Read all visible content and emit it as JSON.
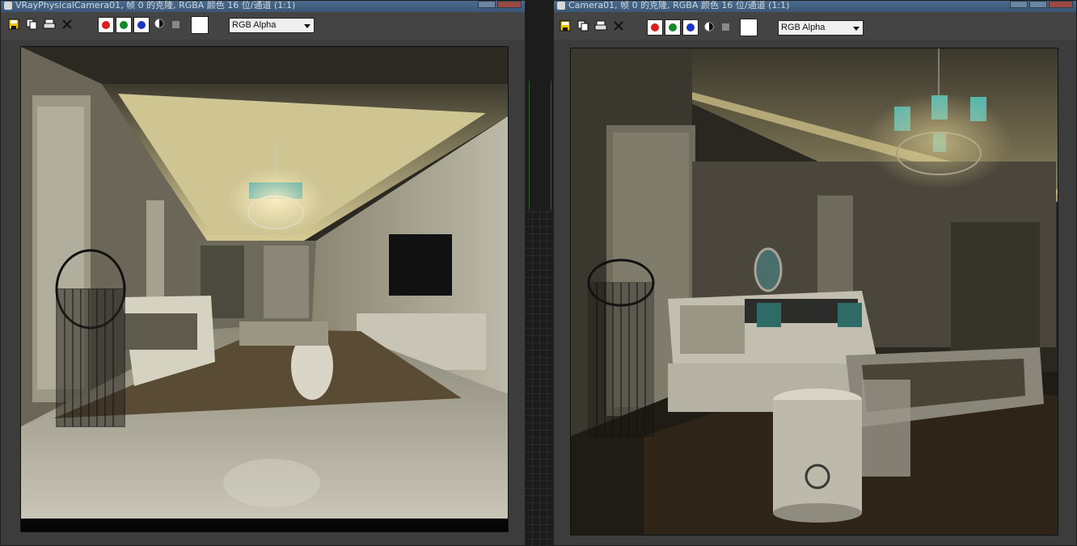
{
  "left_window": {
    "title": "VRayPhysicalCamera01, 帧 0 的克隆, RGBA 颜色 16 位/通道 (1:1)",
    "channel_select": {
      "value": "RGB Alpha"
    }
  },
  "right_window": {
    "title": "Camera01, 帧 0 的克隆, RGBA 颜色 16 位/通道 (1:1)",
    "channel_select": {
      "value": "RGB Alpha"
    }
  },
  "icons": {
    "save": "save-icon",
    "clone": "clone-icon",
    "print": "print-icon",
    "clear": "clear-icon",
    "red": "red-channel-icon",
    "green": "green-channel-icon",
    "blue": "blue-channel-icon",
    "alpha": "alpha-icon",
    "mono": "monochrome-icon"
  },
  "colors": {
    "red_channel": "#d81e1e",
    "green_channel": "#138a2a",
    "blue_channel": "#1a35c4",
    "titlebar": "#4a6b8c",
    "window_bg": "#3c3c3c"
  }
}
